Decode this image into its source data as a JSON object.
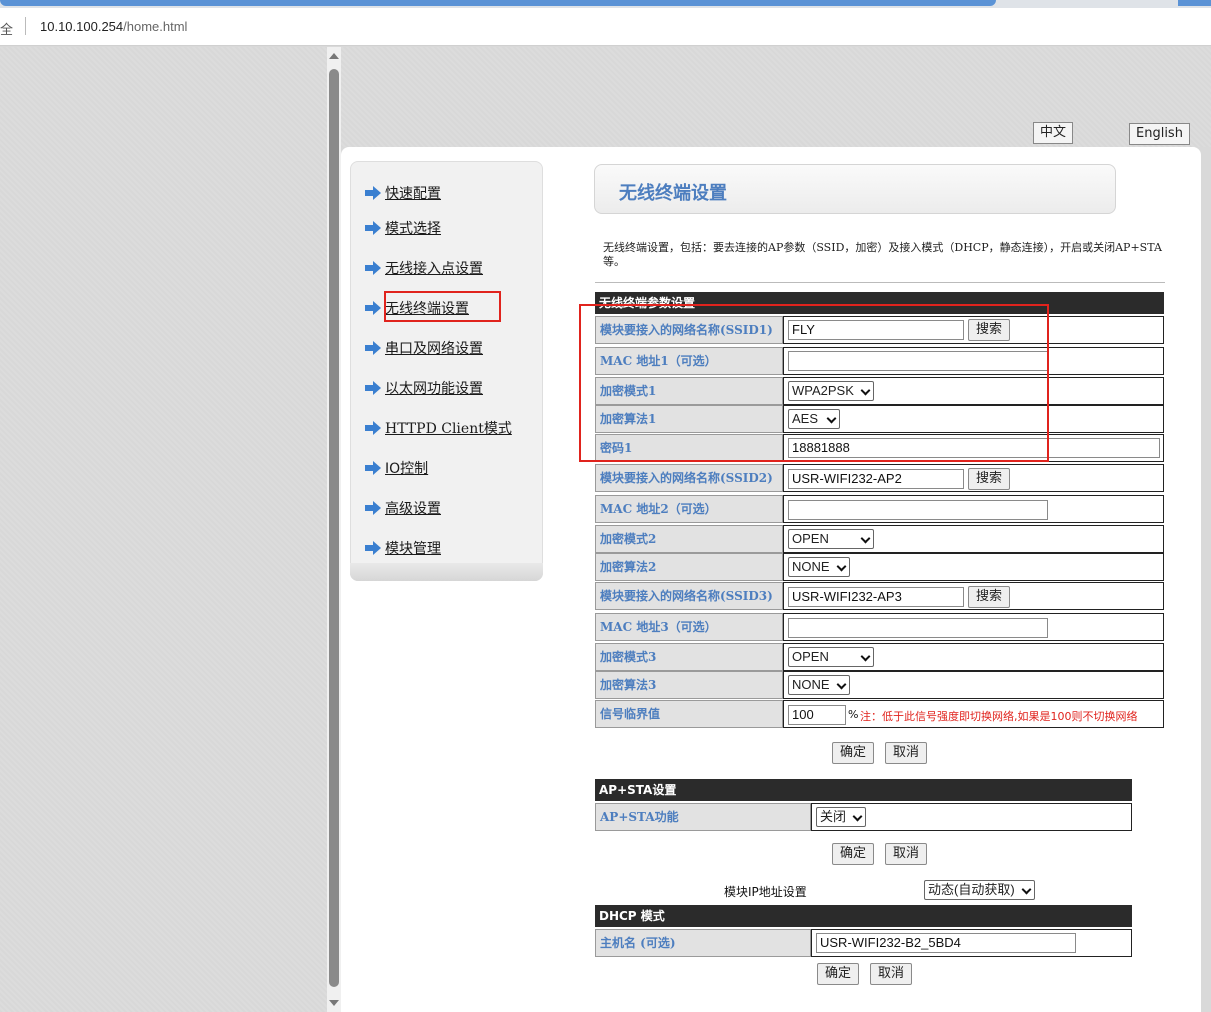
{
  "browser": {
    "secure_label": "全",
    "url_host": "10.10.100.254",
    "url_path": "/home.html"
  },
  "lang": {
    "chinese": "中文",
    "english": "English"
  },
  "sidebar": {
    "items": [
      {
        "label": "快速配置"
      },
      {
        "label": "模式选择"
      },
      {
        "label": "无线接入点设置"
      },
      {
        "label": "无线终端设置"
      },
      {
        "label": "串口及网络设置"
      },
      {
        "label": "以太网功能设置"
      },
      {
        "label": "HTTPD Client模式"
      },
      {
        "label": "IO控制"
      },
      {
        "label": "高级设置"
      },
      {
        "label": "模块管理"
      }
    ]
  },
  "page": {
    "title": "无线终端设置",
    "description": "无线终端设置，包括：要去连接的AP参数（SSID，加密）及接入模式（DHCP，静态连接），开启或关闭AP+STA等。"
  },
  "sta": {
    "header": "无线终端参数设置",
    "ssid1_label": "模块要接入的网络名称(SSID1)",
    "ssid1_value": "FLY",
    "search_label": "搜索",
    "mac1_label": "MAC 地址1（可选）",
    "mac1_value": "",
    "enc_mode1_label": "加密模式1",
    "enc_mode1_value": "WPA2PSK",
    "enc_alg1_label": "加密算法1",
    "enc_alg1_value": "AES",
    "pwd1_label": "密码1",
    "pwd1_value": "18881888",
    "ssid2_label": "模块要接入的网络名称(SSID2)",
    "ssid2_value": "USR-WIFI232-AP2",
    "mac2_label": "MAC 地址2（可选）",
    "mac2_value": "",
    "enc_mode2_label": "加密模式2",
    "enc_mode2_value": "OPEN",
    "enc_alg2_label": "加密算法2",
    "enc_alg2_value": "NONE",
    "ssid3_label": "模块要接入的网络名称(SSID3)",
    "ssid3_value": "USR-WIFI232-AP3",
    "mac3_label": "MAC 地址3（可选）",
    "mac3_value": "",
    "enc_mode3_label": "加密模式3",
    "enc_mode3_value": "OPEN",
    "enc_alg3_label": "加密算法3",
    "enc_alg3_value": "NONE",
    "threshold_label": "信号临界值",
    "threshold_value": "100",
    "threshold_unit": "%",
    "threshold_note": "注：低于此信号强度即切换网络,如果是100则不切换网络"
  },
  "buttons": {
    "ok": "确定",
    "cancel": "取消"
  },
  "apsta": {
    "header": "AP+STA设置",
    "func_label": "AP+STA功能",
    "func_value": "关闭"
  },
  "ipmode": {
    "label": "模块IP地址设置",
    "value": "动态(自动获取)"
  },
  "dhcp": {
    "header": "DHCP 模式",
    "hostname_label": "主机名 (可选)",
    "hostname_value": "USR-WIFI232-B2_5BD4"
  },
  "colors": {
    "label_blue": "#4d7ebf",
    "highlight_red": "#e0231d",
    "header_dark": "#2b2b2b"
  }
}
